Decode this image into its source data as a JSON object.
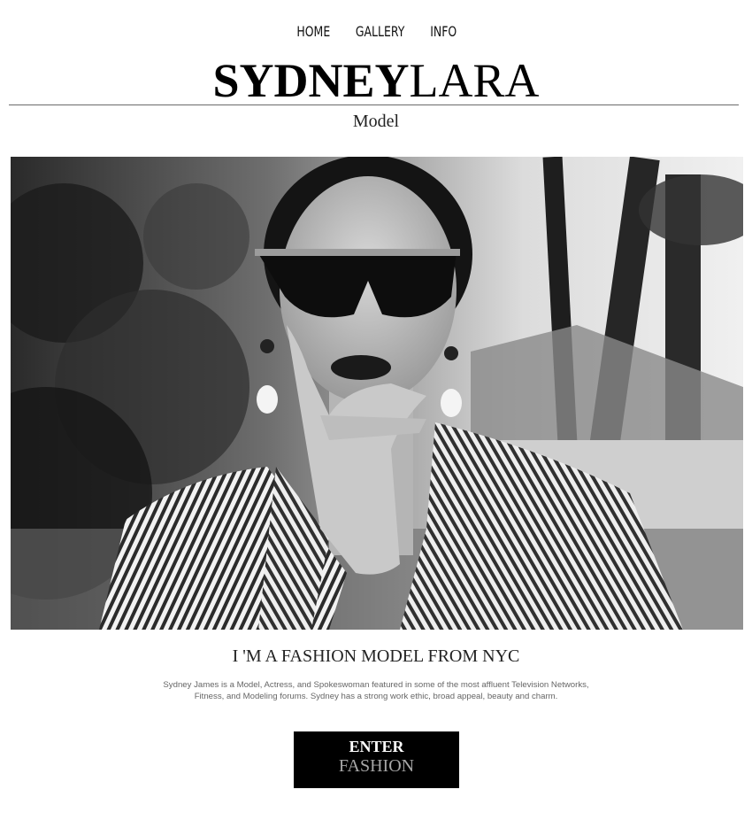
{
  "nav": {
    "items": [
      {
        "label": "HOME"
      },
      {
        "label": "GALLERY"
      },
      {
        "label": "INFO"
      }
    ]
  },
  "logo": {
    "first": "SYDNEY",
    "last": "LARA"
  },
  "subtitle": "Model",
  "hero": {
    "icon": "model-portrait-photo",
    "tone": "black-and-white"
  },
  "headline": "I 'M A FASHION MODEL FROM NYC",
  "blurb": {
    "line1": "Sydney James is a Model, Actress, and Spokeswoman featured in some of the most affluent Television Networks,",
    "line2": "Fitness, and Modeling forums. Sydney has a strong work ethic, broad appeal, beauty and charm."
  },
  "enter_button": {
    "line1": "ENTER",
    "line2": "FASHION"
  },
  "colors": {
    "background": "#ffffff",
    "button": "#000000",
    "button_sub": "#a6a6a6",
    "rule": "#6b6b6b"
  }
}
